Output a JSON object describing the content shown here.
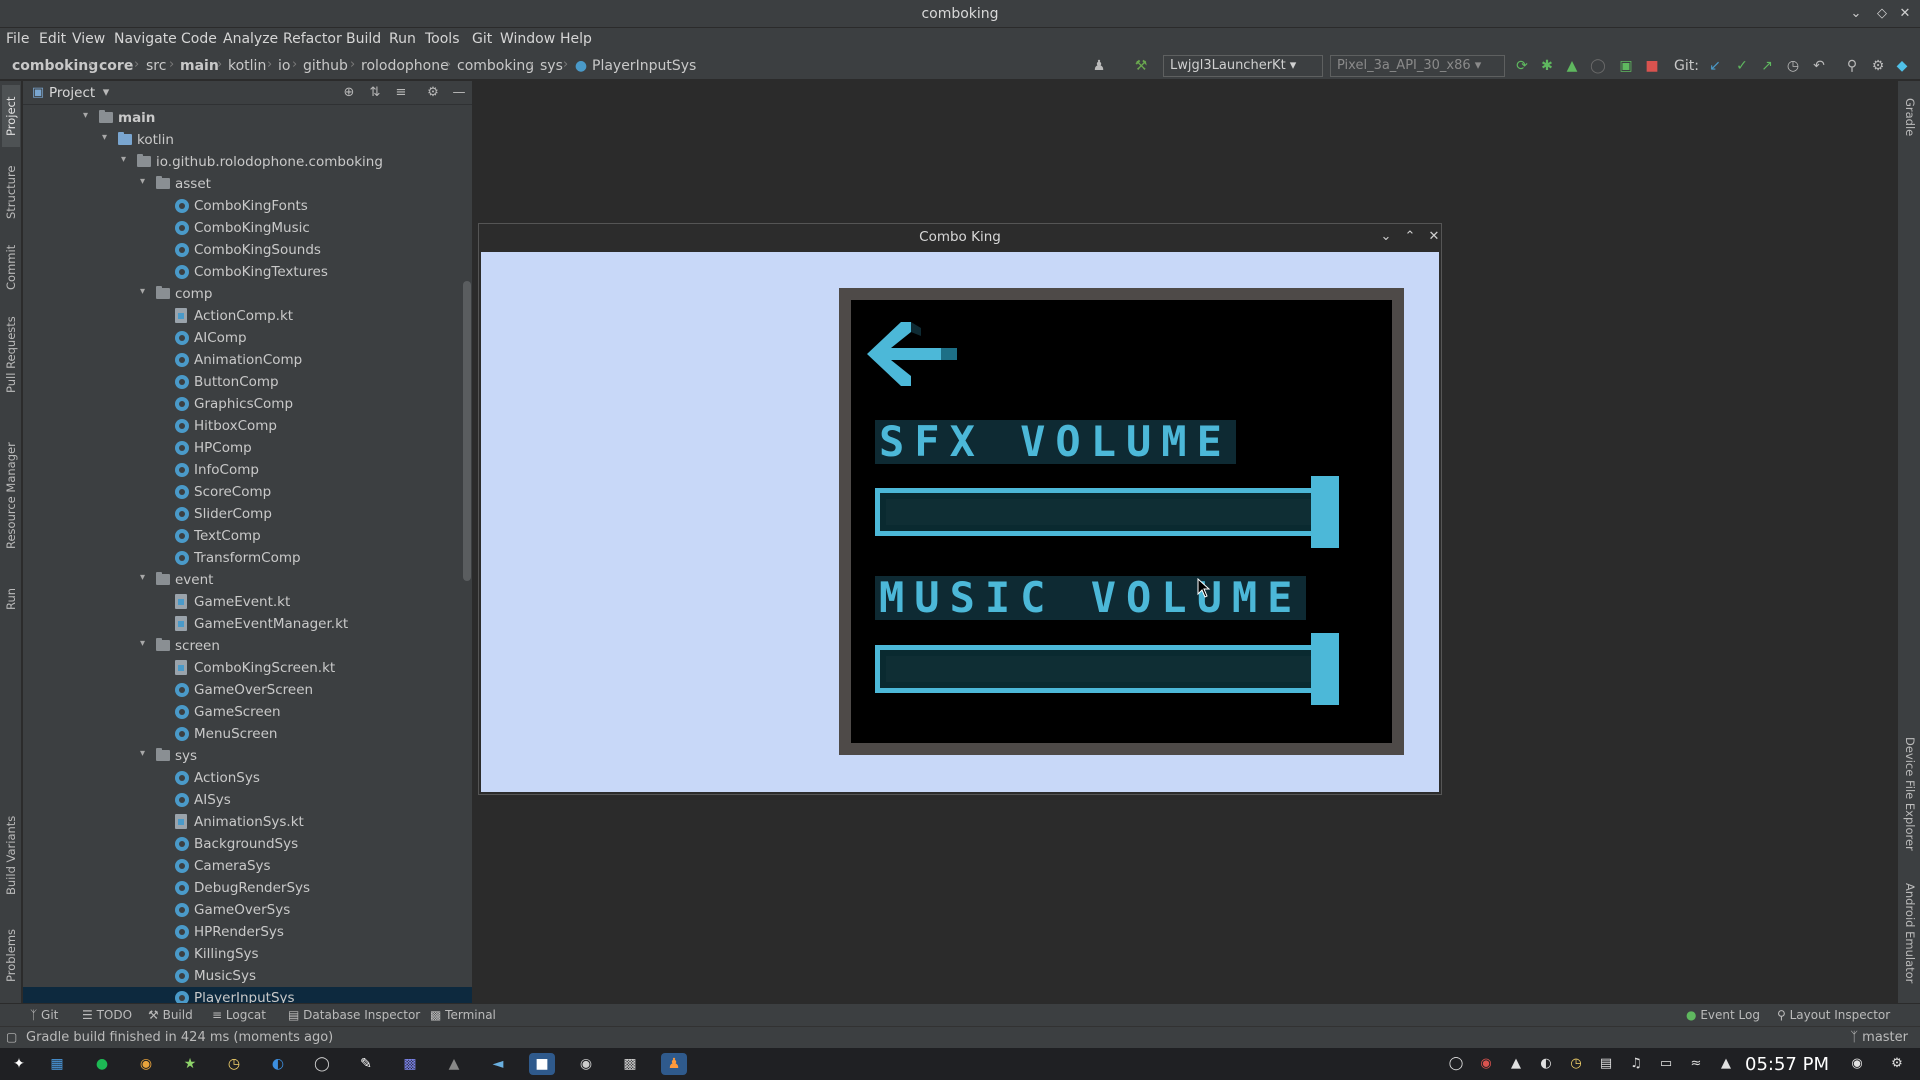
{
  "window": {
    "title": "comboking"
  },
  "menu": [
    "File",
    "Edit",
    "View",
    "Navigate",
    "Code",
    "Analyze",
    "Refactor",
    "Build",
    "Run",
    "Tools",
    "Git",
    "Window",
    "Help"
  ],
  "breadcrumb": [
    "comboking",
    "core",
    "src",
    "main",
    "kotlin",
    "io",
    "github",
    "rolodophone",
    "comboking",
    "sys",
    "PlayerInputSys"
  ],
  "toolbar": {
    "run_config": "Lwjgl3LauncherKt",
    "device": "Pixel_3a_API_30_x86",
    "git_label": "Git:"
  },
  "left_tabs": [
    "Project",
    "Structure",
    "Commit",
    "Pull Requests",
    "Resource Manager",
    "Run",
    "Build Variants",
    "Problems"
  ],
  "right_tabs": [
    "Gradle",
    "Device File Explorer",
    "Android Emulator"
  ],
  "project": {
    "title": "Project",
    "tree": [
      {
        "label": "main",
        "type": "folder",
        "level": 0,
        "open": true,
        "bold": true
      },
      {
        "label": "kotlin",
        "type": "folder-blue",
        "level": 1,
        "open": true
      },
      {
        "label": "io.github.rolodophone.comboking",
        "type": "folder",
        "level": 2,
        "open": true
      },
      {
        "label": "asset",
        "type": "folder",
        "level": 3,
        "open": true
      },
      {
        "label": "ComboKingFonts",
        "type": "class",
        "level": 4
      },
      {
        "label": "ComboKingMusic",
        "type": "class",
        "level": 4
      },
      {
        "label": "ComboKingSounds",
        "type": "class",
        "level": 4
      },
      {
        "label": "ComboKingTextures",
        "type": "class",
        "level": 4
      },
      {
        "label": "comp",
        "type": "folder",
        "level": 3,
        "open": true
      },
      {
        "label": "ActionComp.kt",
        "type": "file",
        "level": 4
      },
      {
        "label": "AIComp",
        "type": "class",
        "level": 4
      },
      {
        "label": "AnimationComp",
        "type": "class",
        "level": 4
      },
      {
        "label": "ButtonComp",
        "type": "class",
        "level": 4
      },
      {
        "label": "GraphicsComp",
        "type": "class",
        "level": 4
      },
      {
        "label": "HitboxComp",
        "type": "class",
        "level": 4
      },
      {
        "label": "HPComp",
        "type": "class",
        "level": 4
      },
      {
        "label": "InfoComp",
        "type": "class",
        "level": 4
      },
      {
        "label": "ScoreComp",
        "type": "class",
        "level": 4
      },
      {
        "label": "SliderComp",
        "type": "class",
        "level": 4
      },
      {
        "label": "TextComp",
        "type": "class",
        "level": 4
      },
      {
        "label": "TransformComp",
        "type": "class",
        "level": 4
      },
      {
        "label": "event",
        "type": "folder",
        "level": 3,
        "open": true
      },
      {
        "label": "GameEvent.kt",
        "type": "file",
        "level": 4
      },
      {
        "label": "GameEventManager.kt",
        "type": "file",
        "level": 4
      },
      {
        "label": "screen",
        "type": "folder",
        "level": 3,
        "open": true
      },
      {
        "label": "ComboKingScreen.kt",
        "type": "file",
        "level": 4
      },
      {
        "label": "GameOverScreen",
        "type": "class",
        "level": 4
      },
      {
        "label": "GameScreen",
        "type": "class",
        "level": 4
      },
      {
        "label": "MenuScreen",
        "type": "class",
        "level": 4
      },
      {
        "label": "sys",
        "type": "folder",
        "level": 3,
        "open": true
      },
      {
        "label": "ActionSys",
        "type": "class",
        "level": 4
      },
      {
        "label": "AISys",
        "type": "class",
        "level": 4
      },
      {
        "label": "AnimationSys.kt",
        "type": "file",
        "level": 4
      },
      {
        "label": "BackgroundSys",
        "type": "class",
        "level": 4
      },
      {
        "label": "CameraSys",
        "type": "class",
        "level": 4
      },
      {
        "label": "DebugRenderSys",
        "type": "class",
        "level": 4
      },
      {
        "label": "GameOverSys",
        "type": "class",
        "level": 4
      },
      {
        "label": "HPRenderSys",
        "type": "class",
        "level": 4
      },
      {
        "label": "KillingSys",
        "type": "class",
        "level": 4
      },
      {
        "label": "MusicSys",
        "type": "class",
        "level": 4
      },
      {
        "label": "PlayerInputSys",
        "type": "class",
        "level": 4,
        "selected": true
      }
    ]
  },
  "game": {
    "title": "Combo King",
    "sfx_label": "SFX VOLUME",
    "music_label": "MUSIC VOLUME",
    "sfx_level": 1.0,
    "music_level": 1.0
  },
  "bottom_tabs": [
    "Git",
    "TODO",
    "Build",
    "Logcat",
    "Database Inspector",
    "Terminal"
  ],
  "bottom_right_tabs": [
    "Event Log",
    "Layout Inspector"
  ],
  "status": {
    "message": "Gradle build finished in 424 ms (moments ago)",
    "branch": "master"
  },
  "clock": "05:57 PM",
  "colors": {
    "accent": "#4cb8d8",
    "game_bg": "#c8d8f8",
    "panel_border": "#4e4a48",
    "ide_bg": "#2b2b2b",
    "ide_panel": "#3c3f41"
  }
}
